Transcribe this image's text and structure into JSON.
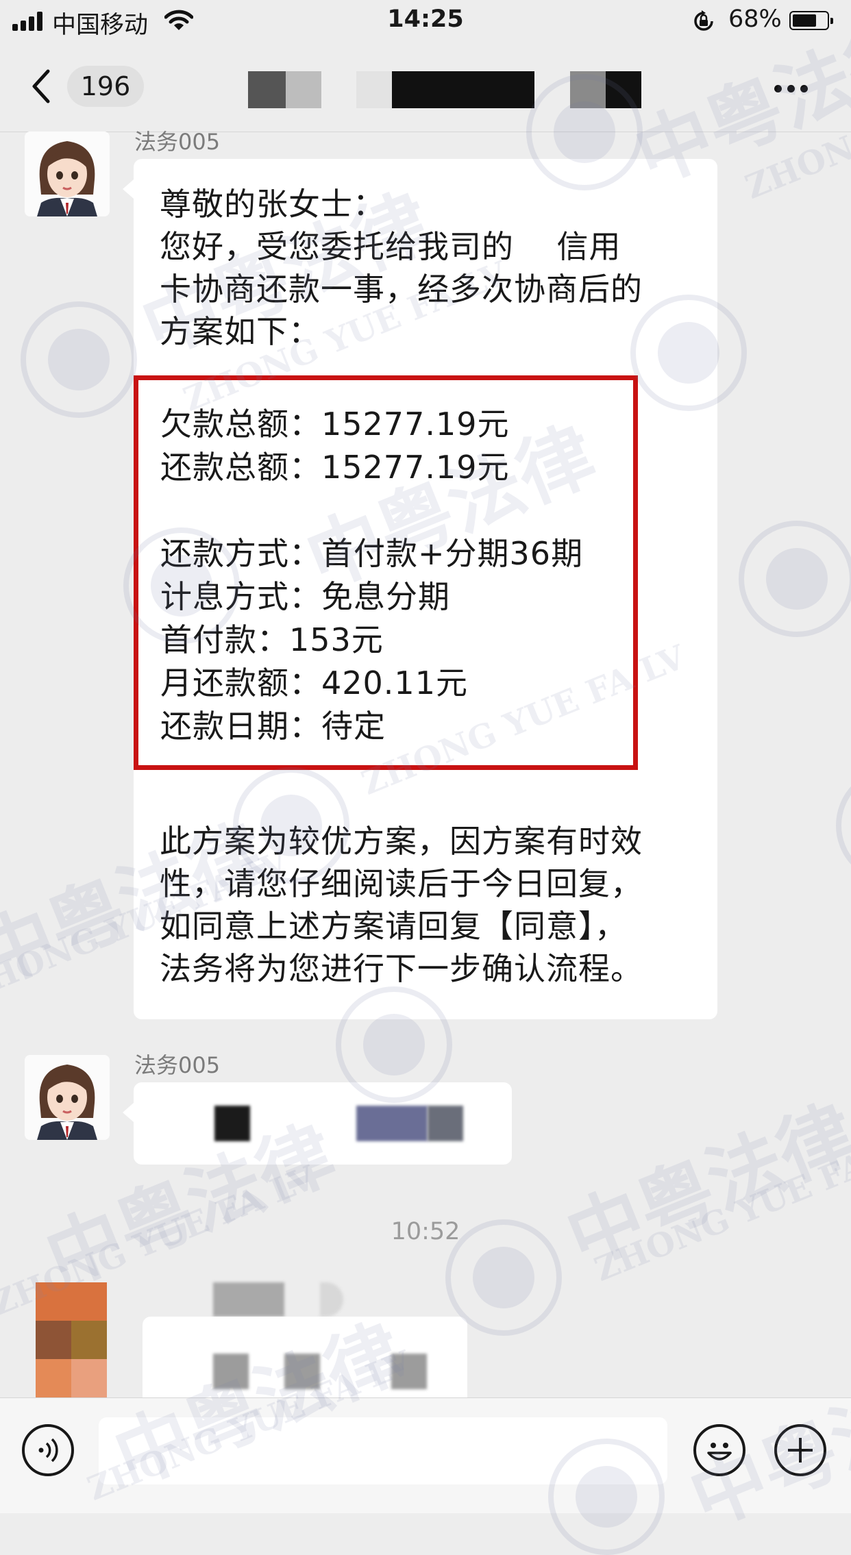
{
  "status_bar": {
    "carrier": "中国移动",
    "time": "14:25",
    "battery_percent": "68%",
    "battery_level": 0.68
  },
  "nav": {
    "unread_count": "196"
  },
  "messages": [
    {
      "sender": "法务005",
      "greeting_lines": [
        "尊敬的张女士：",
        "您好，受您委托给我司的    信用",
        "卡协商还款一事，经多次协商后的",
        "方案如下："
      ],
      "plan": [
        {
          "label": "欠款总额：",
          "value": "15277.19元"
        },
        {
          "label": "还款总额：",
          "value": "15277.19元"
        },
        {
          "label": "还款方式：",
          "value": "首付款+分期36期"
        },
        {
          "label": "计息方式：",
          "value": "免息分期"
        },
        {
          "label": "首付款：",
          "value": "153元"
        },
        {
          "label": "月还款额：",
          "value": "420.11元"
        },
        {
          "label": "还款日期：",
          "value": "待定"
        }
      ],
      "closing_lines": [
        "此方案为较优方案，因方案有时效",
        "性，请您仔细阅读后于今日回复，",
        "如同意上述方案请回复【同意】，",
        "法务将为您进行下一步确认流程。"
      ]
    },
    {
      "sender": "法务005"
    }
  ],
  "timestamp": "10:52",
  "watermark": {
    "brand_cn": "中粤法律",
    "brand_en": "ZHONG YUE FA LV"
  },
  "colors": {
    "background": "#ededed",
    "bubble": "#ffffff",
    "highlight_box": "#c81212"
  },
  "icons": [
    "back-chevron-icon",
    "more-icon",
    "voice-icon",
    "emoji-icon",
    "plus-icon"
  ]
}
